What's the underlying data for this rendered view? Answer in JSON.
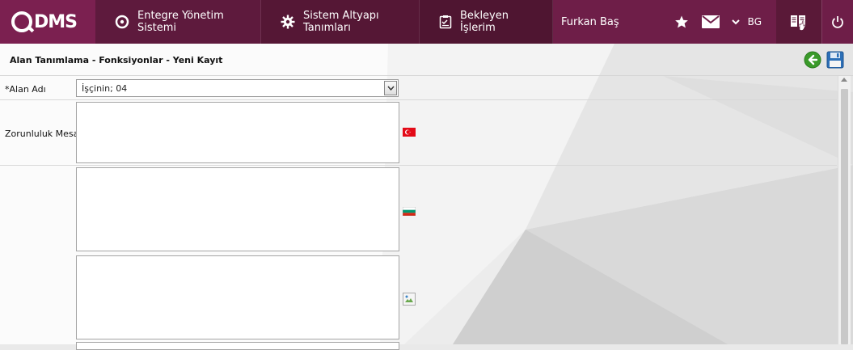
{
  "app": {
    "logo_text": "DMS"
  },
  "nav": {
    "items": [
      {
        "label": "Entegre Yönetim Sistemi",
        "icon": "qdms-circle-icon"
      },
      {
        "label": "Sistem Altyapı Tanımları",
        "icon": "gear-icon"
      },
      {
        "label": "Bekleyen İşlerim",
        "icon": "clipboard-icon"
      }
    ]
  },
  "user": {
    "name": "Furkan Baş",
    "language": "BG"
  },
  "page": {
    "title": "Alan Tanımlama - Fonksiyonlar - Yeni Kayıt"
  },
  "form": {
    "alan_adi_label": "*Alan Adı",
    "alan_adi_value": "İşçinin;  04",
    "zorunluluk_label": "Zorunluluk Mesajı",
    "messages": [
      {
        "lang": "tr",
        "value": ""
      },
      {
        "lang": "bg",
        "value": ""
      },
      {
        "lang": "unknown",
        "value": ""
      }
    ]
  },
  "colors": {
    "topbar": "#6b1d45",
    "accent": "#7b2050",
    "back_button": "#3a9a2a",
    "save_button": "#2c6fb7"
  }
}
